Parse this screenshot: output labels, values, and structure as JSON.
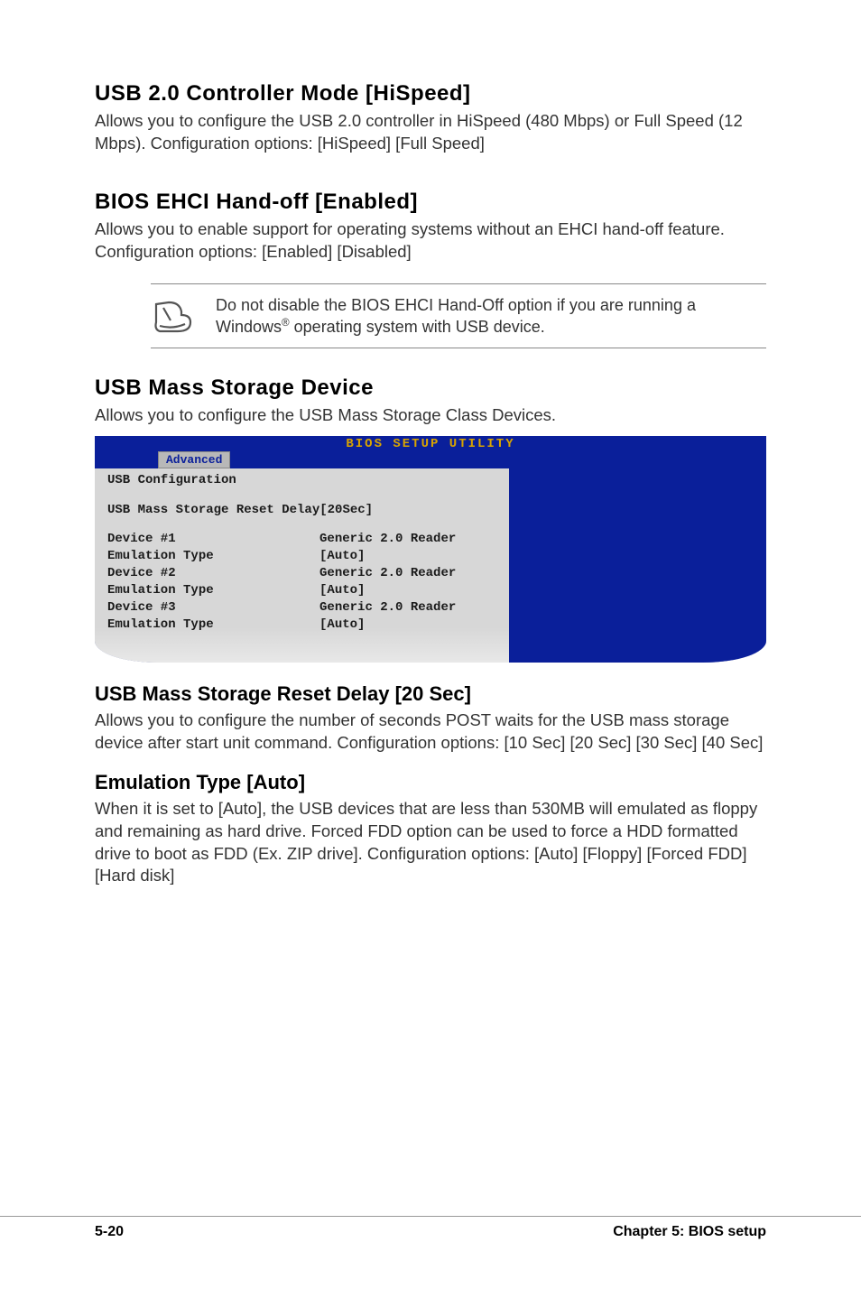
{
  "sections": {
    "usb20": {
      "title": "USB 2.0 Controller Mode [HiSpeed]",
      "body": "Allows you to configure the USB 2.0 controller in HiSpeed (480 Mbps) or Full Speed (12 Mbps). Configuration options: [HiSpeed] [Full Speed]"
    },
    "ehci": {
      "title": "BIOS EHCI Hand-off [Enabled]",
      "body": "Allows you to enable support for operating systems without an EHCI hand-off feature. Configuration options: [Enabled] [Disabled]"
    },
    "note": {
      "text_pre": "Do not disable the BIOS EHCI Hand-Off option if you are running a Windows",
      "reg": "®",
      "text_post": " operating system with USB device."
    },
    "mass_device": {
      "title": "USB Mass Storage Device",
      "body": "Allows you to configure the USB Mass Storage Class Devices."
    },
    "reset_delay": {
      "title": "USB Mass Storage Reset Delay [20 Sec]",
      "body": "Allows you to configure the number of seconds POST waits for the USB mass storage device after start unit command. Configuration options: [10 Sec] [20 Sec] [30 Sec] [40 Sec]"
    },
    "emulation": {
      "title": "Emulation Type [Auto]",
      "body": "When it is set to [Auto], the USB devices that are less than 530MB will emulated as floppy and remaining as hard drive. Forced FDD option can be used to force a HDD formatted drive to boot as FDD (Ex. ZIP drive]. Configuration options: [Auto] [Floppy] [Forced FDD] [Hard disk]"
    }
  },
  "bios": {
    "header": "BIOS SETUP UTILITY",
    "tab": "Advanced",
    "group_title": "USB Configuration",
    "reset_delay_row": {
      "label": "USB Mass Storage Reset Delay",
      "value": "[20Sec]"
    },
    "rows": [
      {
        "label": "Device #1",
        "value": "Generic 2.0 Reader"
      },
      {
        "label": "Emulation Type",
        "value": "[Auto]"
      },
      {
        "label": "Device #2",
        "value": "Generic 2.0 Reader"
      },
      {
        "label": "Emulation Type",
        "value": "[Auto]"
      },
      {
        "label": "Device #3",
        "value": "Generic 2.0 Reader"
      },
      {
        "label": "Emulation Type",
        "value": "[Auto]"
      }
    ]
  },
  "footer": {
    "left": "5-20",
    "right": "Chapter 5: BIOS setup"
  }
}
